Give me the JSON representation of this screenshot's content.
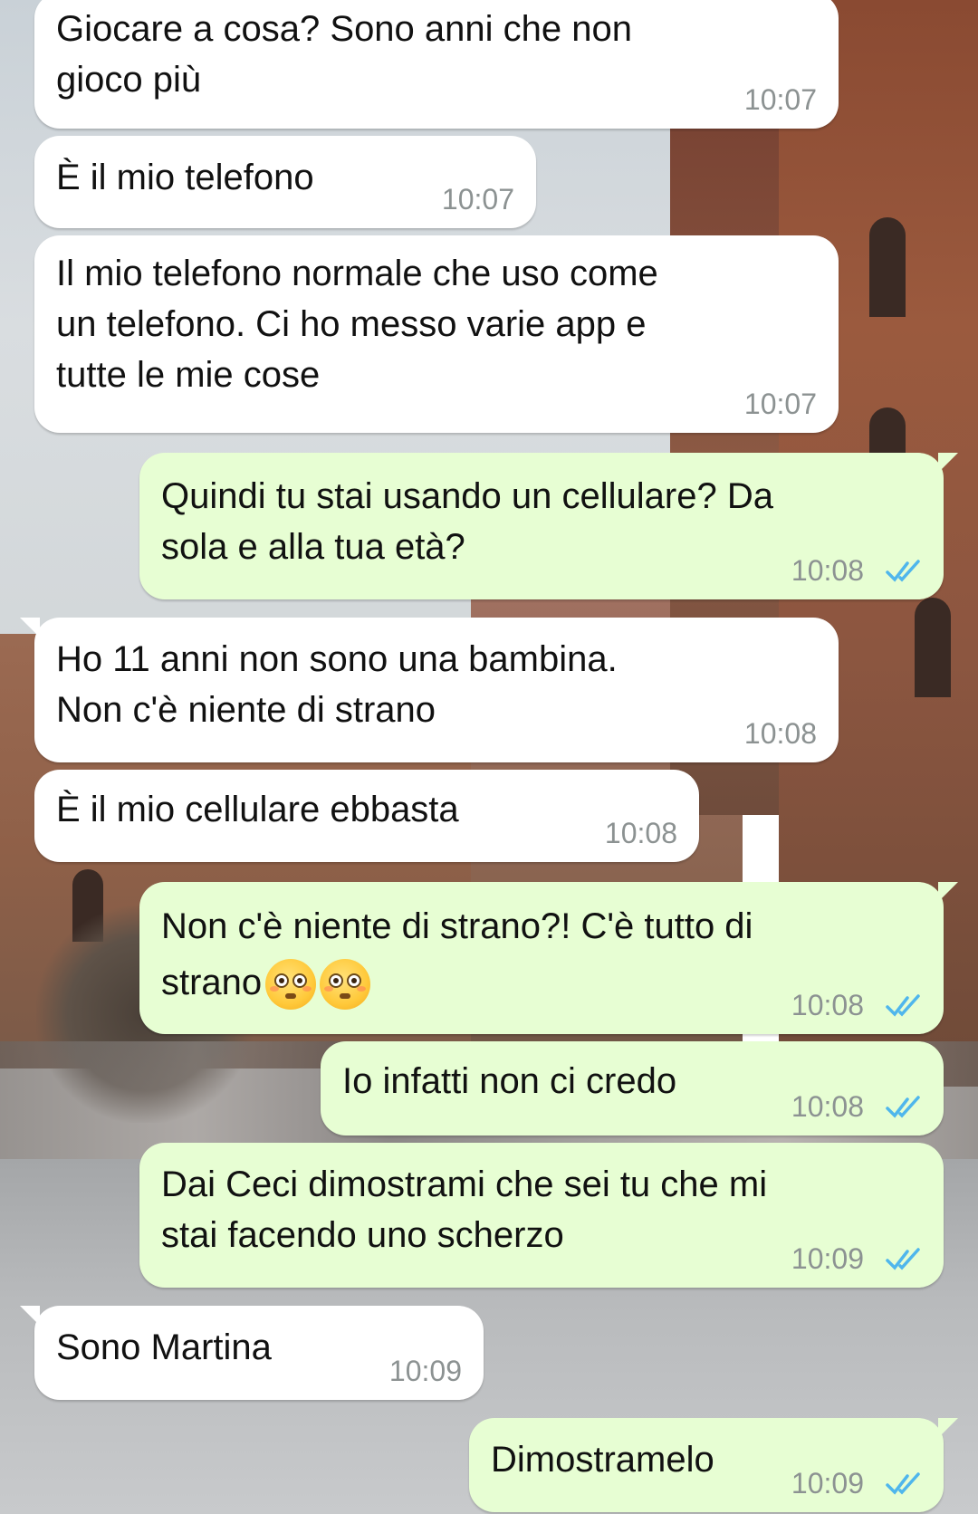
{
  "colors": {
    "incoming_bubble": "#ffffff",
    "outgoing_bubble": "#e7fed3",
    "timestamp": "#8c9292",
    "read_ticks": "#4fb6ec"
  },
  "messages": [
    {
      "direction": "incoming",
      "text": "Giocare a cosa? Sono anni che non\ngioco più",
      "time": "10:07"
    },
    {
      "direction": "incoming",
      "text": "È il mio telefono",
      "time": "10:07"
    },
    {
      "direction": "incoming",
      "text": "Il mio telefono normale che uso come\nun telefono. Ci ho messo varie app e\ntutte le mie cose",
      "time": "10:07"
    },
    {
      "direction": "outgoing",
      "text": "Quindi tu stai usando un cellulare? Da\nsola e alla tua età?",
      "time": "10:08",
      "status": "read-ticks-icon"
    },
    {
      "direction": "incoming",
      "text": "Ho 11 anni non sono una bambina.\nNon c'è niente di strano",
      "time": "10:08"
    },
    {
      "direction": "incoming",
      "text": "È il mio cellulare ebbasta",
      "time": "10:08"
    },
    {
      "direction": "outgoing",
      "text": "Non c'è niente di strano?! C'è tutto di\nstrano",
      "emoji": "flushed-face-icon",
      "time": "10:08",
      "status": "read-ticks-icon"
    },
    {
      "direction": "outgoing",
      "text": "Io infatti non ci credo",
      "time": "10:08",
      "status": "read-ticks-icon"
    },
    {
      "direction": "outgoing",
      "text": "Dai Ceci dimostrami che sei tu che mi\nstai facendo uno scherzo",
      "time": "10:09",
      "status": "read-ticks-icon"
    },
    {
      "direction": "incoming",
      "text": "Sono Martina",
      "time": "10:09"
    },
    {
      "direction": "outgoing",
      "text": "Dimostramelo",
      "time": "10:09",
      "status": "read-ticks-icon"
    }
  ]
}
